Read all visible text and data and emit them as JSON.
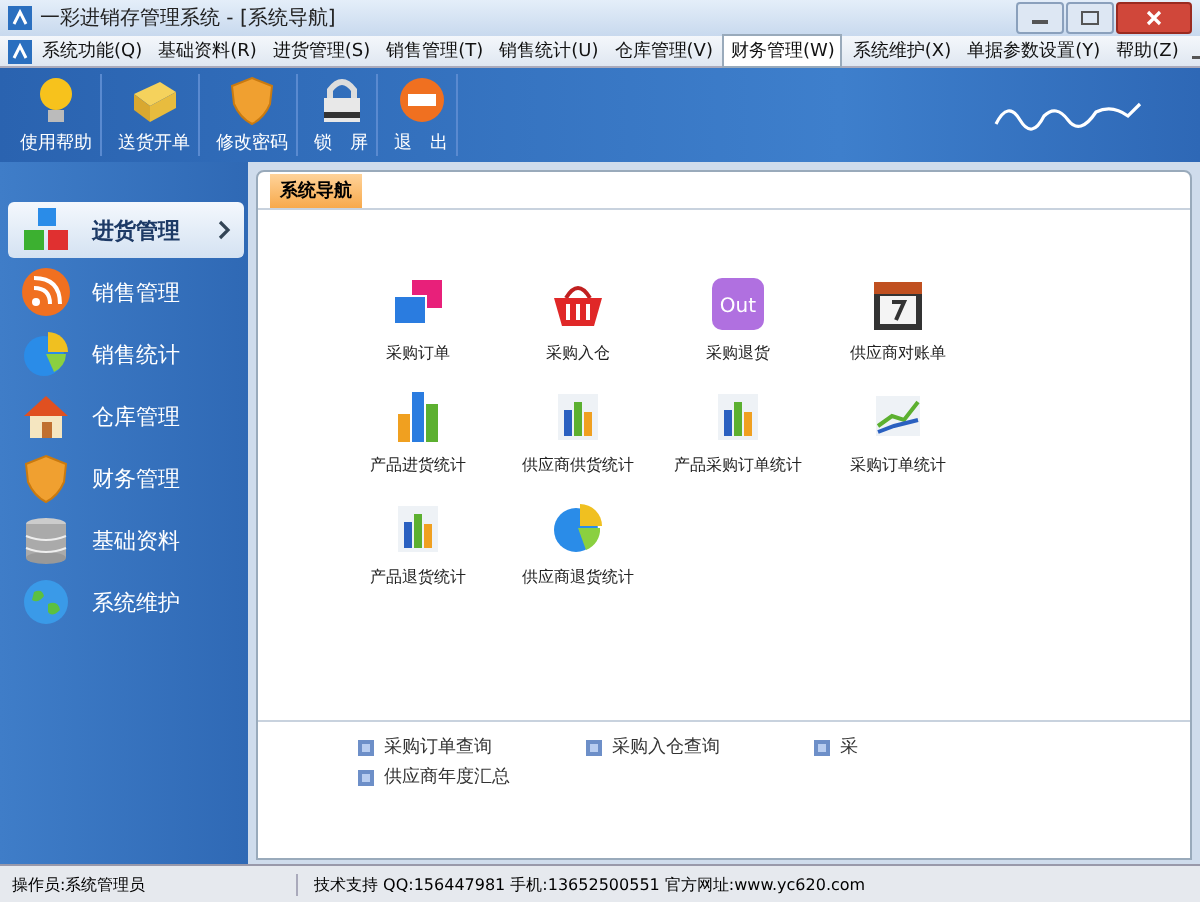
{
  "window": {
    "title": "一彩进销存管理系统 - [系统导航]"
  },
  "menu": [
    {
      "label": "系统功能(Q)",
      "selected": false
    },
    {
      "label": "基础资料(R)",
      "selected": false
    },
    {
      "label": "进货管理(S)",
      "selected": false
    },
    {
      "label": "销售管理(T)",
      "selected": false
    },
    {
      "label": "销售统计(U)",
      "selected": false
    },
    {
      "label": "仓库管理(V)",
      "selected": false
    },
    {
      "label": "财务管理(W)",
      "selected": true
    },
    {
      "label": "系统维护(X)",
      "selected": false
    },
    {
      "label": "单据参数设置(Y)",
      "selected": false
    },
    {
      "label": "帮助(Z)",
      "selected": false
    }
  ],
  "toolbar": [
    {
      "label": "使用帮助",
      "kind": "bulb"
    },
    {
      "label": "送货开单",
      "kind": "box"
    },
    {
      "label": "修改密码",
      "kind": "shield"
    },
    {
      "label": "锁　屏",
      "kind": "lock"
    },
    {
      "label": "退　出",
      "kind": "exit"
    }
  ],
  "sidebar": {
    "items": [
      {
        "label": "进货管理",
        "kind": "blocks",
        "selected": true
      },
      {
        "label": "销售管理",
        "kind": "rss",
        "selected": false
      },
      {
        "label": "销售统计",
        "kind": "pie",
        "selected": false
      },
      {
        "label": "仓库管理",
        "kind": "house",
        "selected": false
      },
      {
        "label": "财务管理",
        "kind": "shield",
        "selected": false
      },
      {
        "label": "基础资料",
        "kind": "db",
        "selected": false
      },
      {
        "label": "系统维护",
        "kind": "globe",
        "selected": false
      }
    ]
  },
  "tabs": [
    {
      "label": "系统导航",
      "selected": true
    }
  ],
  "shortcuts": [
    {
      "label": "采购订单",
      "kind": "windows"
    },
    {
      "label": "采购入仓",
      "kind": "basket"
    },
    {
      "label": "采购退货",
      "kind": "out",
      "icon_text": "Out"
    },
    {
      "label": "供应商对账单",
      "kind": "calendar"
    },
    {
      "label": "产品进货统计",
      "kind": "bars"
    },
    {
      "label": "供应商供货统计",
      "kind": "book"
    },
    {
      "label": "产品采购订单统计",
      "kind": "book"
    },
    {
      "label": "采购订单统计",
      "kind": "line"
    },
    {
      "label": "产品退货统计",
      "kind": "book"
    },
    {
      "label": "供应商退货统计",
      "kind": "pie"
    }
  ],
  "links": [
    "采购订单查询",
    "采购入仓查询",
    "采",
    "供应商年度汇总"
  ],
  "status_bar": {
    "operator": "操作员:系统管理员",
    "support": "技术支持 QQ:156447981 手机:13652500551 官方网址:www.yc620.com"
  }
}
